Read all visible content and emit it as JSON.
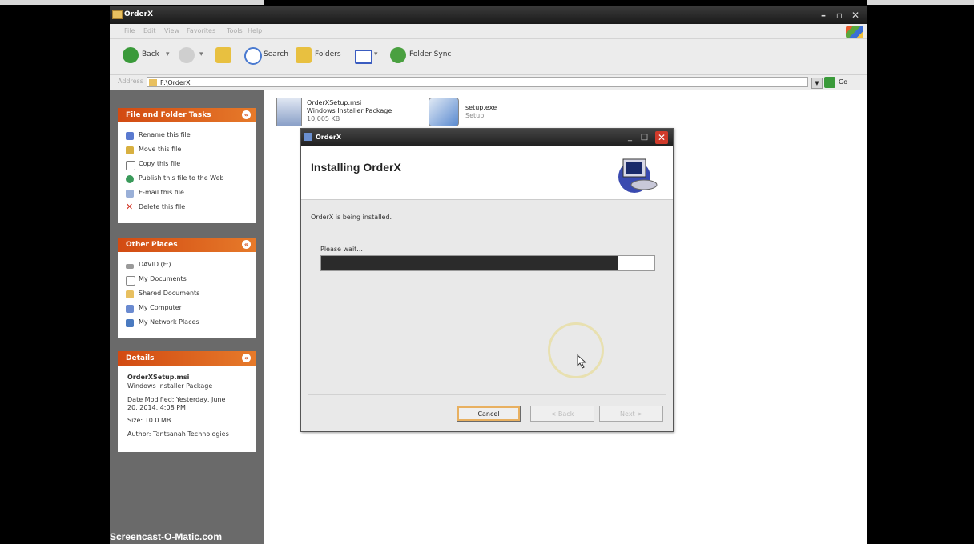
{
  "window": {
    "title": "OrderX",
    "controls": [
      "minimize-icon",
      "maximize-icon",
      "close-icon"
    ]
  },
  "menu": [
    "File",
    "Edit",
    "View",
    "Favorites",
    "Tools",
    "Help"
  ],
  "toolbar": {
    "back_label": "Back",
    "search_label": "Search",
    "folders_label": "Folders",
    "folder_sync_label": "Folder Sync"
  },
  "address": {
    "label": "Address",
    "value": "F:\\OrderX",
    "go_label": "Go"
  },
  "file_tasks": {
    "title": "File and Folder Tasks",
    "items": [
      {
        "label": "Rename this file",
        "icon": "rename-icon"
      },
      {
        "label": "Move this file",
        "icon": "move-icon"
      },
      {
        "label": "Copy this file",
        "icon": "copy-icon"
      },
      {
        "label": "Publish this file to the Web",
        "icon": "publish-icon"
      },
      {
        "label": "E-mail this file",
        "icon": "email-icon"
      },
      {
        "label": "Delete this file",
        "icon": "delete-icon"
      }
    ]
  },
  "other_places": {
    "title": "Other Places",
    "items": [
      {
        "label": "DAVID (F:)",
        "icon": "drive-icon"
      },
      {
        "label": "My Documents",
        "icon": "documents-icon"
      },
      {
        "label": "Shared Documents",
        "icon": "folder-icon"
      },
      {
        "label": "My Computer",
        "icon": "computer-icon"
      },
      {
        "label": "My Network Places",
        "icon": "network-icon"
      }
    ]
  },
  "details": {
    "title": "Details",
    "filename": "OrderXSetup.msi",
    "filetype": "Windows Installer Package",
    "modified_line1": "Date Modified: Yesterday, June",
    "modified_line2": "20, 2014, 4:08 PM",
    "size": "Size: 10.0 MB",
    "author": "Author: Tantsanah Technologies"
  },
  "files": [
    {
      "name": "OrderXSetup.msi",
      "type": "Windows Installer Package",
      "size": "10,005 KB"
    },
    {
      "name": "setup.exe",
      "type": "Setup"
    }
  ],
  "dialog": {
    "title": "OrderX",
    "heading": "Installing OrderX",
    "status": "OrderX is being installed.",
    "wait_label": "Please wait...",
    "progress": 0.89,
    "cancel_label": "Cancel",
    "back_label": "< Back",
    "next_label": "Next >"
  },
  "watermark": "Screencast-O-Matic.com",
  "colors": {
    "task_header": "#d24a12",
    "progress_fill": "#2b2b2b",
    "close_button": "#d03a2a"
  }
}
